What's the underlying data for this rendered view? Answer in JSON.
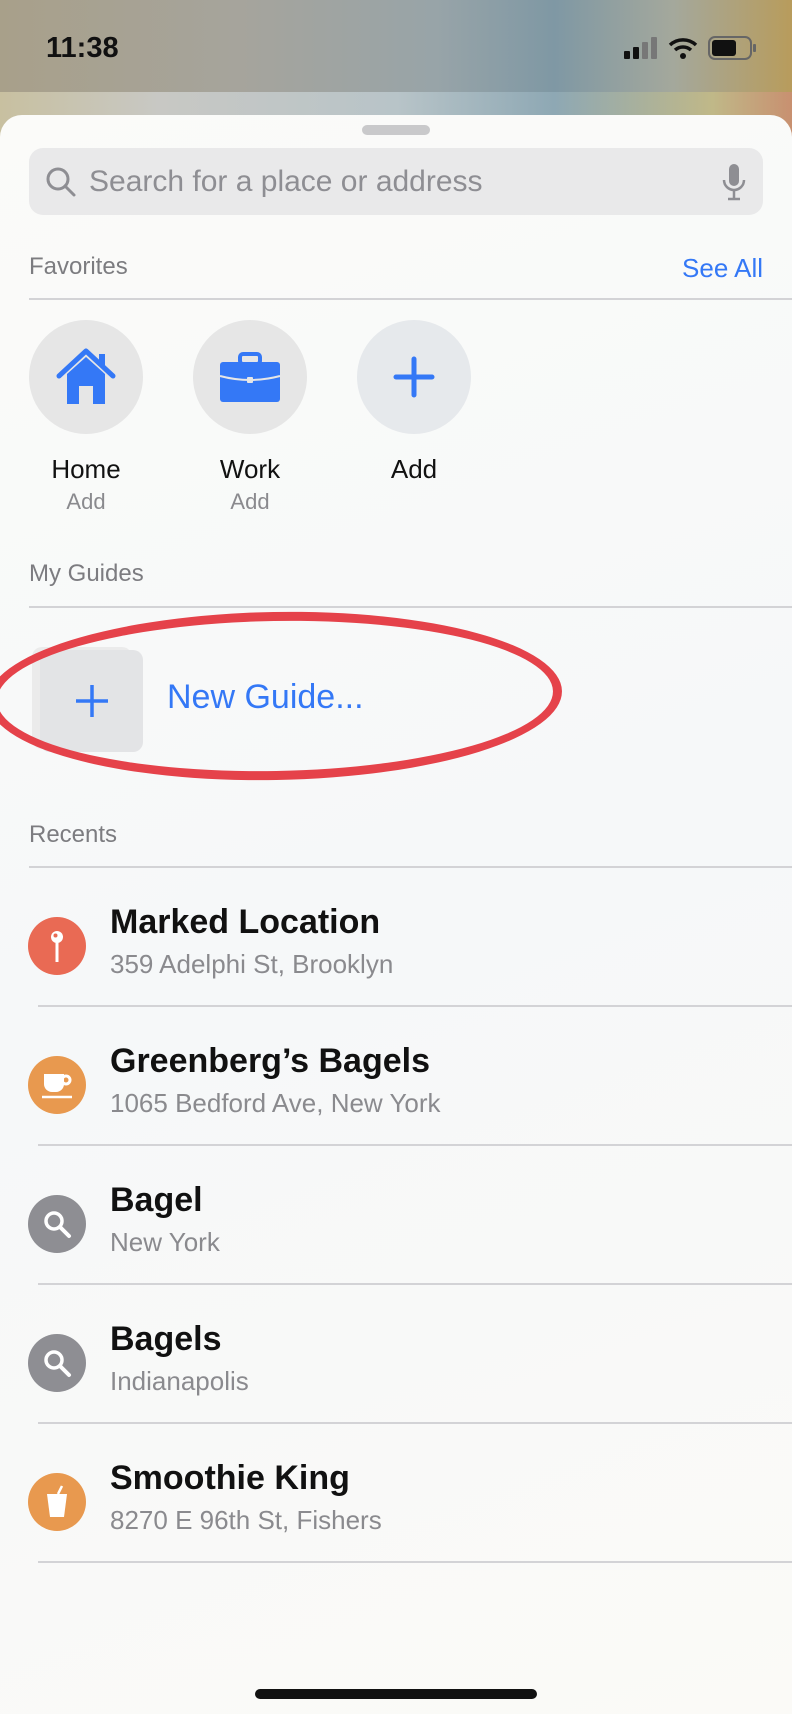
{
  "status_bar": {
    "time": "11:38"
  },
  "search": {
    "placeholder": "Search for a place or address"
  },
  "favorites": {
    "title": "Favorites",
    "see_all": "See All",
    "items": [
      {
        "label": "Home",
        "sub": "Add",
        "icon": "house-icon"
      },
      {
        "label": "Work",
        "sub": "Add",
        "icon": "briefcase-icon"
      },
      {
        "label": "Add",
        "icon": "plus-icon"
      }
    ]
  },
  "guides": {
    "title": "My Guides",
    "new_guide": "New Guide..."
  },
  "recents": {
    "title": "Recents",
    "items": [
      {
        "title": "Marked Location",
        "subtitle": "359 Adelphi St, Brooklyn",
        "icon": "pin-icon",
        "color": "#e96a54"
      },
      {
        "title": "Greenberg’s Bagels",
        "subtitle": "1065 Bedford Ave, New York",
        "icon": "coffee-cup-icon",
        "color": "#e8994f"
      },
      {
        "title": "Bagel",
        "subtitle": "New York",
        "icon": "search-icon",
        "color": "#8e8e93"
      },
      {
        "title": "Bagels",
        "subtitle": "Indianapolis",
        "icon": "search-icon",
        "color": "#8e8e93"
      },
      {
        "title": "Smoothie King",
        "subtitle": "8270 E 96th St, Fishers",
        "icon": "drink-icon",
        "color": "#e8994f"
      }
    ]
  },
  "colors": {
    "accent": "#3478f6",
    "annotation": "#e5424a"
  }
}
